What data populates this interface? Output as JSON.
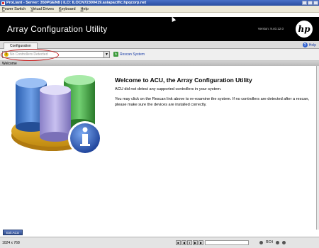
{
  "window": {
    "title": "ProLiant - Server: 350PGEN8 | iLO: ILOCN72300419.asiapacific.hpqcorp.net"
  },
  "menu": [
    "Power Switch",
    "Virtual Drives",
    "Keyboard",
    "Help"
  ],
  "banner": {
    "title": "Array Configuration Utility",
    "version": "Version: 9.40.12.0",
    "logo": "hp"
  },
  "tabs": {
    "configuration": "Configuration",
    "help": "Help"
  },
  "toolbar": {
    "controller_select_value": "No Controllers Detected",
    "rescan_label": "Rescan System"
  },
  "section_label": "Welcome",
  "welcome": {
    "title": "Welcome to ACU, the Array Configuration Utility",
    "message1": "ACU did not detect any supported controllers in your system.",
    "message2": "You may click on the Rescan link above to re-examine the system. If no controllers are detected after a rescan, please make sure the devices are installed correctly."
  },
  "footer": {
    "exit_label": "Exit ACU"
  },
  "statusbar": {
    "resolution": "1024 x 768",
    "connection": "RC4"
  },
  "icons": {
    "warning": "warning-icon",
    "rescan": "rescan-icon",
    "help": "help-icon",
    "info": "info-icon"
  },
  "colors": {
    "banner_bg": "#000000",
    "highlight": "#c82020",
    "link": "#1a3ea8"
  }
}
